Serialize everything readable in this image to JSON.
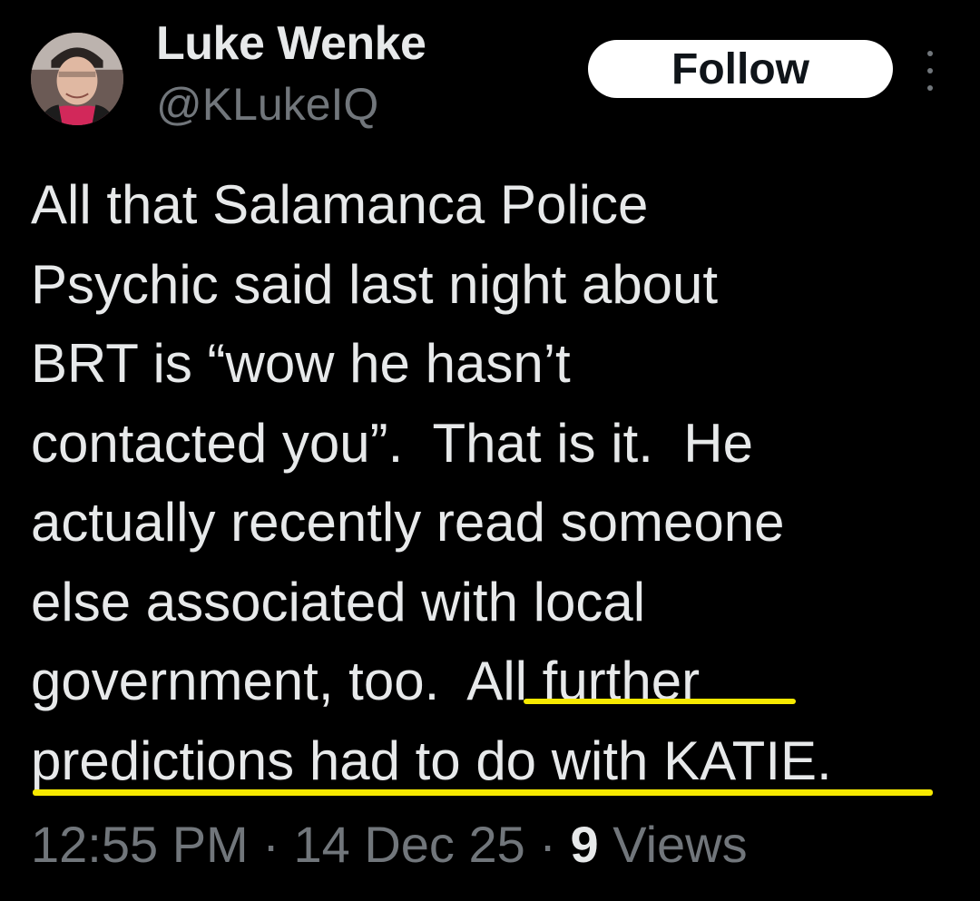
{
  "author": {
    "display_name": "Luke Wenke",
    "handle": "@KLukeIQ"
  },
  "actions": {
    "follow_label": "Follow",
    "more_icon": "more-vertical-icon"
  },
  "post": {
    "lines": [
      "All that Salamanca Police",
      "Psychic said last night about",
      "BRT is “wow he hasn’t",
      "contacted you”.  That is it.  He",
      "actually recently read someone",
      "else associated with local",
      "government, too.  All further",
      "predictions had to do with KATIE."
    ],
    "highlight_color": "#f6e900"
  },
  "meta": {
    "time": "12:55 PM",
    "sep1": " · ",
    "date": "14 Dec 25",
    "sep2": " · ",
    "views_count": "9",
    "views_label": " Views"
  },
  "colors": {
    "background": "#000000",
    "primary_text": "#e7e9ea",
    "secondary_text": "#71767b",
    "follow_bg": "#ffffff"
  }
}
